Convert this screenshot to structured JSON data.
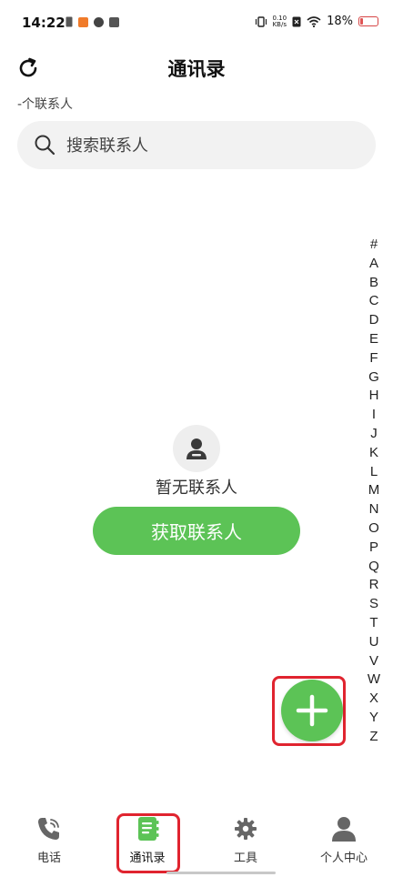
{
  "status_bar": {
    "time": "14:22",
    "net_speed_value": "0.10",
    "net_speed_unit": "KB/s",
    "battery_percent_label": "18%",
    "battery_level": 0.18
  },
  "header": {
    "title": "通讯录",
    "refresh_icon": "refresh-icon"
  },
  "contacts": {
    "count_label": "-个联系人"
  },
  "search": {
    "placeholder": "搜索联系人"
  },
  "index_letters": [
    "#",
    "A",
    "B",
    "C",
    "D",
    "E",
    "F",
    "G",
    "H",
    "I",
    "J",
    "K",
    "L",
    "M",
    "N",
    "O",
    "P",
    "Q",
    "R",
    "S",
    "T",
    "U",
    "V",
    "W",
    "X",
    "Y",
    "Z"
  ],
  "empty_state": {
    "message": "暂无联系人",
    "button_label": "获取联系人"
  },
  "fab": {
    "icon": "plus-icon"
  },
  "bottom_nav": {
    "items": [
      {
        "label": "电话",
        "icon": "phone-icon"
      },
      {
        "label": "通讯录",
        "icon": "contacts-book-icon"
      },
      {
        "label": "工具",
        "icon": "gear-icon"
      },
      {
        "label": "个人中心",
        "icon": "person-icon"
      }
    ],
    "active_index": 1
  },
  "colors": {
    "accent_green": "#5cc356",
    "highlight_red": "#e0242f",
    "search_bg": "#f2f2f2"
  }
}
